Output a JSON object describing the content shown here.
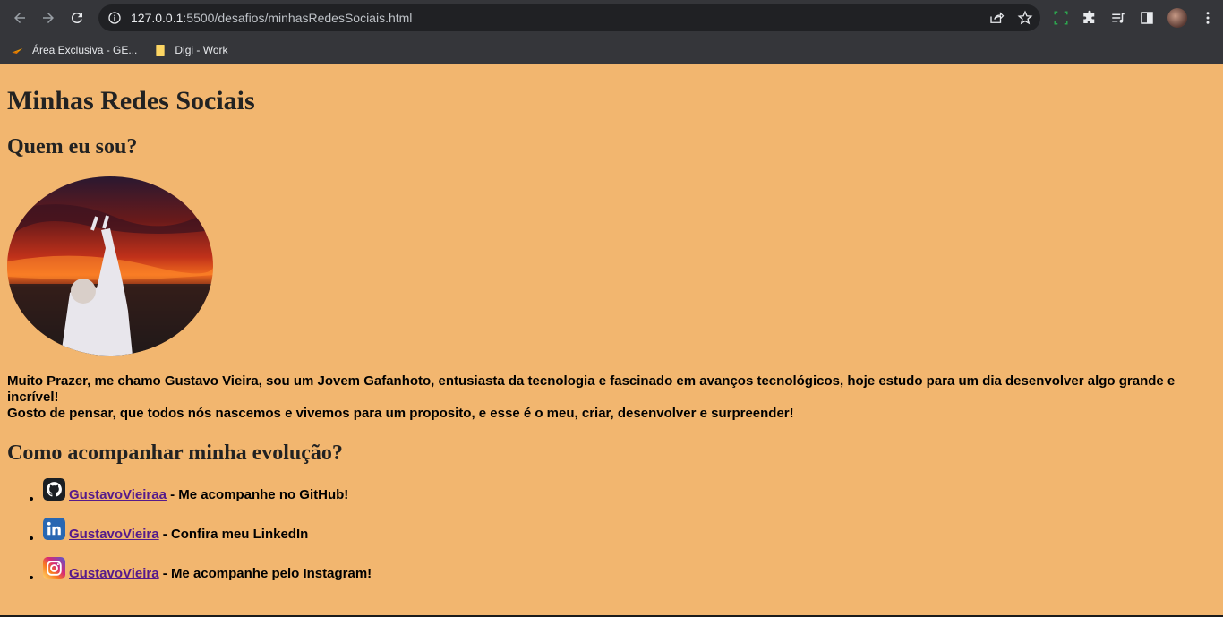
{
  "browser": {
    "url_host": "127.0.0.1",
    "url_path": ":5500/desafios/minhasRedesSociais.html",
    "bookmarks": [
      {
        "label": "Área Exclusiva - GE..."
      },
      {
        "label": "Digi - Work"
      }
    ]
  },
  "page": {
    "title": "Minhas Redes Sociais",
    "who_heading": "Quem eu sou?",
    "bio_line1": "Muito Prazer, me chamo Gustavo Vieira, sou um Jovem Gafanhoto, entusiasta da tecnologia e fascinado em avanços tecnológicos, hoje estudo para um dia desenvolver algo grande e incrível!",
    "bio_line2": "Gosto de pensar, que todos nós nascemos e vivemos para um proposito, e esse é o meu, criar, desenvolver e surpreender!",
    "evolution_heading": "Como acompanhar minha evolução?",
    "socials": [
      {
        "icon": "github-icon",
        "handle": "GustavoVieiraa",
        "text": " - Me acompanhe no GitHub!"
      },
      {
        "icon": "linkedin-icon",
        "handle": "GustavoVieira",
        "text": " - Confira meu LinkedIn"
      },
      {
        "icon": "instagram-icon",
        "handle": "GustavoVieira",
        "text": " - Me acompanhe pelo Instagram!"
      }
    ]
  },
  "colors": {
    "page_background": "#f2b66f",
    "link_visited": "#551a8b"
  }
}
